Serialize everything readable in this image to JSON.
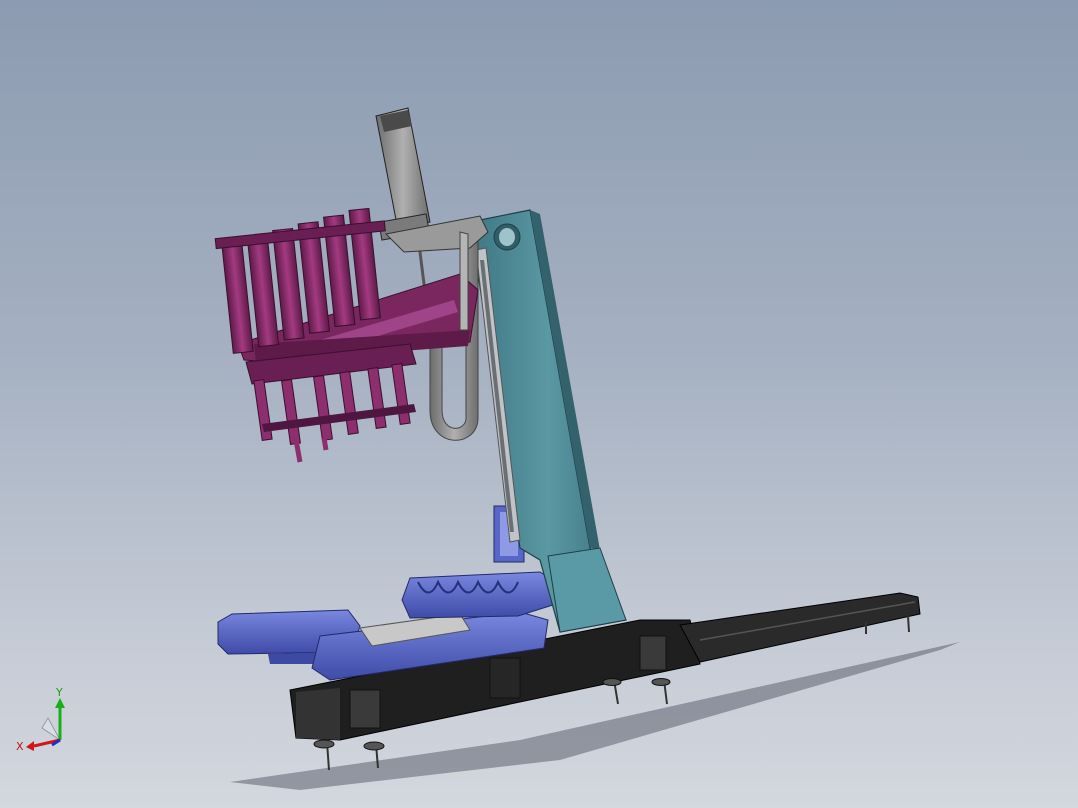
{
  "triad": {
    "x_label": "X",
    "y_label": "Y",
    "colors": {
      "x": "#d01616",
      "y": "#18b018",
      "z": "#1a2fd0"
    }
  },
  "colors": {
    "background_top": "#8c9bb1",
    "background_bottom": "#d3d7de",
    "column": "#4d8a96",
    "gripper": "#8a2b6a",
    "conveyor": "#5765c6",
    "frame": "#2a2a2a",
    "motor": "#8c8c8c"
  }
}
